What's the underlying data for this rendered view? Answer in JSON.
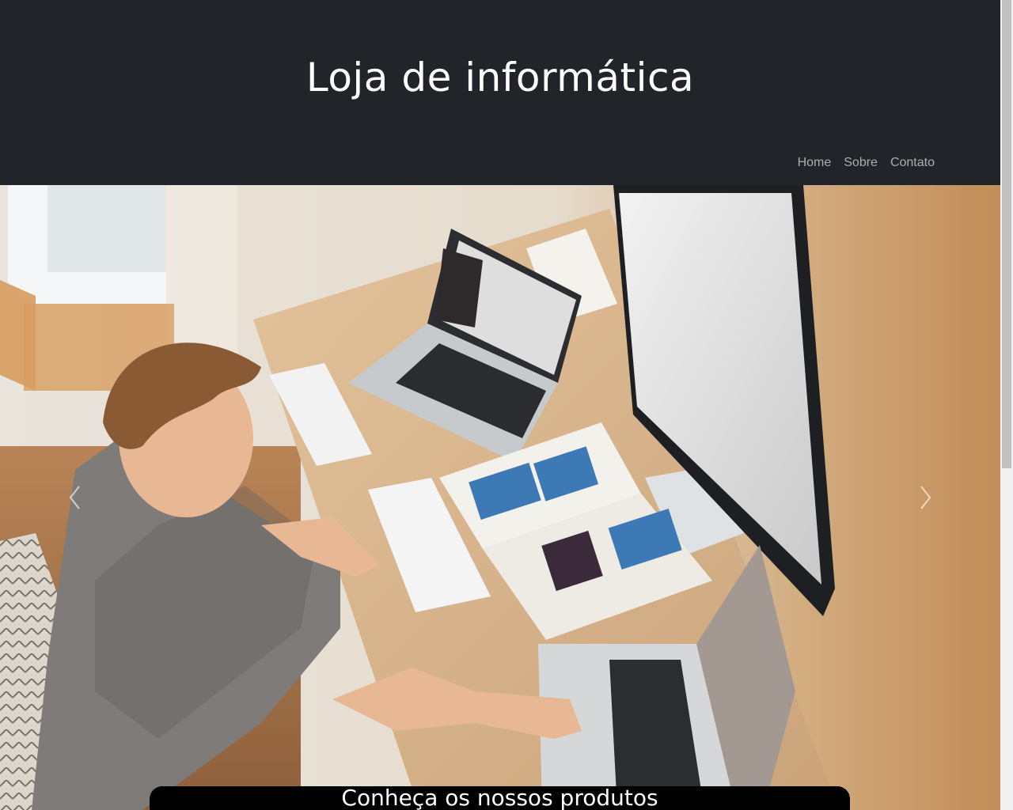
{
  "header": {
    "title": "Loja de informática",
    "nav": [
      {
        "label": "Home"
      },
      {
        "label": "Sobre"
      },
      {
        "label": "Contato"
      }
    ]
  },
  "carousel": {
    "caption": "Conheça os nossos produtos",
    "prev_icon": "chevron-left-icon",
    "next_icon": "chevron-right-icon"
  },
  "colors": {
    "header_bg": "#212529",
    "caption_bg": "#000000",
    "text": "#ffffff"
  }
}
